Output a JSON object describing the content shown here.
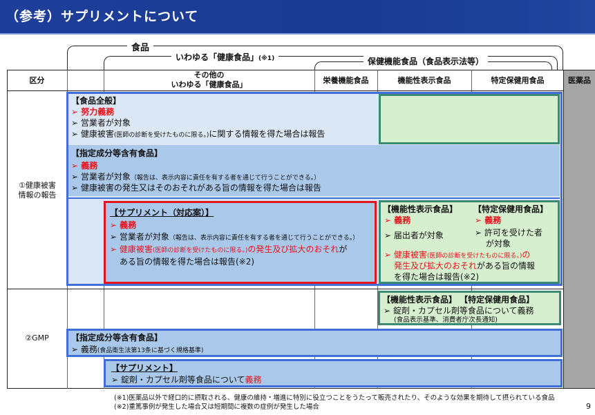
{
  "title": "（参考）サプリメントについて",
  "top_labels": {
    "food": "食品",
    "health_food": "いわゆる「健康食品」",
    "health_food_note": "(※1)",
    "claims_food": "保健機能食品（食品表示法等）"
  },
  "headers": {
    "category": "区分",
    "other_health_food_line1": "その他の",
    "other_health_food_line2": "いわゆる「健康食品」",
    "nutrient_function": "栄養機能食品",
    "function_claims": "機能性表示食品",
    "foshu": "特定保健用食品",
    "pharma": "医薬品"
  },
  "rows": {
    "report_line1": "①健康被害",
    "report_line2": "情報の報告",
    "gmp": "②GMP"
  },
  "general_food": {
    "title": "【食品全般】",
    "l1": "➢ 努力義務",
    "l2": "➢ 営業者が対象",
    "l3_main": "➢ 健康被害",
    "l3_small": "(医師の診断を受けたものに限る。)",
    "l3_tail": "に関する情報を得た場合は報告"
  },
  "designated_report": {
    "title": "【指定成分等含有食品】",
    "l1": "➢ 義務",
    "l2_main": "➢ 営業者が対象",
    "l2_small": "（報告は、表示内容に責任を有する者を通じて行うことができる。）",
    "l3": "➢ 健康被害の発生又はそのおそれがある旨の情報を得た場合は報告"
  },
  "supplement_proposal": {
    "title": "【サプリメント（対応案）】",
    "l1": "➢ 義務",
    "l2_main": "➢ 営業者が対象",
    "l2_small": "（報告は、表示内容に責任を有する者を通じて行うことができる。）",
    "l3_red": "➢ 健康被害",
    "l3_small": "(医師の診断を受けたものに限る。)",
    "l3_red2": "の発生及び拡大のおそれ",
    "l3_tail": "が",
    "l4": "ある旨の情報を得た場合は報告(※2)"
  },
  "claims_report": {
    "func_title": "【機能性表示食品】",
    "foshu_title": "【特定保健用食品】",
    "func_l1": "➢ 義務",
    "func_l2": "➢ 届出者が対象",
    "foshu_l1": "➢ 義務",
    "foshu_l2": "➢ 許可を受けた者",
    "foshu_l3": "が対象",
    "l3_red": "➢ 健康被害",
    "l3_small": "(医師の診断を受けたものに限る。)",
    "l3_red_tail": "の",
    "l4_red": "発生及び拡大のおそれ",
    "l4_tail": "がある旨の情報",
    "l5": "を得た場合は報告(※2)"
  },
  "claims_gmp": {
    "title": "【機能性表示食品】 【特定保健用食品】",
    "l1": "➢ 錠剤・カプセル剤等食品について義務",
    "l2": "(食品表示基準、消費者庁次長通知)"
  },
  "designated_gmp": {
    "title": "【指定成分等含有食品】",
    "l1": "➢ 義務",
    "l1_small": "(食品衛生法第13条に基づく規格基準)"
  },
  "supplement_gmp": {
    "title": "【サプリメント】",
    "l1": "➢ 錠剤・カプセル剤等食品について",
    "l1_red": "義務"
  },
  "notes": {
    "n1": "(※1)医薬品以外で経口的に摂取される、健康の維持・増進に特別に役立つことをうたって販売されたり、そのような効果を期待して摂られている食品",
    "n2": "(※2)重篤事例が発生した場合又は短期間に複数の症例が発生した場合"
  },
  "page_number": "9",
  "colors": {
    "title_bar": "#1d3f9a",
    "panel_border": "#3f6ed8",
    "panel_light": "#dbe7f5",
    "panel_mid": "#a9c8ea",
    "green_fill": "#d6efcf",
    "green_border": "#3a8a74",
    "emphasis_red": "#e8141d",
    "pharma_gray": "#a6a6a6"
  }
}
